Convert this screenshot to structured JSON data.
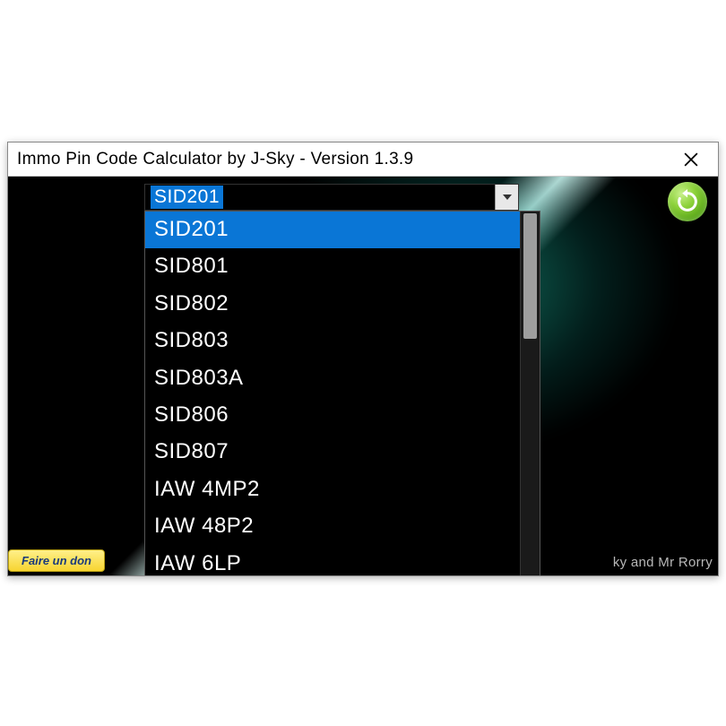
{
  "window": {
    "title": "Immo Pin Code Calculator by J-Sky  -  Version 1.3.9"
  },
  "combo": {
    "selected": "SID201"
  },
  "dropdown": {
    "items": [
      {
        "label": "SID201",
        "selected": true
      },
      {
        "label": "SID801",
        "selected": false
      },
      {
        "label": "SID802",
        "selected": false
      },
      {
        "label": "SID803",
        "selected": false
      },
      {
        "label": "SID803A",
        "selected": false
      },
      {
        "label": "SID806",
        "selected": false
      },
      {
        "label": "SID807",
        "selected": false
      },
      {
        "label": "IAW 4MP2",
        "selected": false
      },
      {
        "label": "IAW 48P2",
        "selected": false
      },
      {
        "label": "IAW 6LP",
        "selected": false
      }
    ]
  },
  "footer": {
    "donate": "Faire un don",
    "credit": "ky and Mr Rorry"
  }
}
